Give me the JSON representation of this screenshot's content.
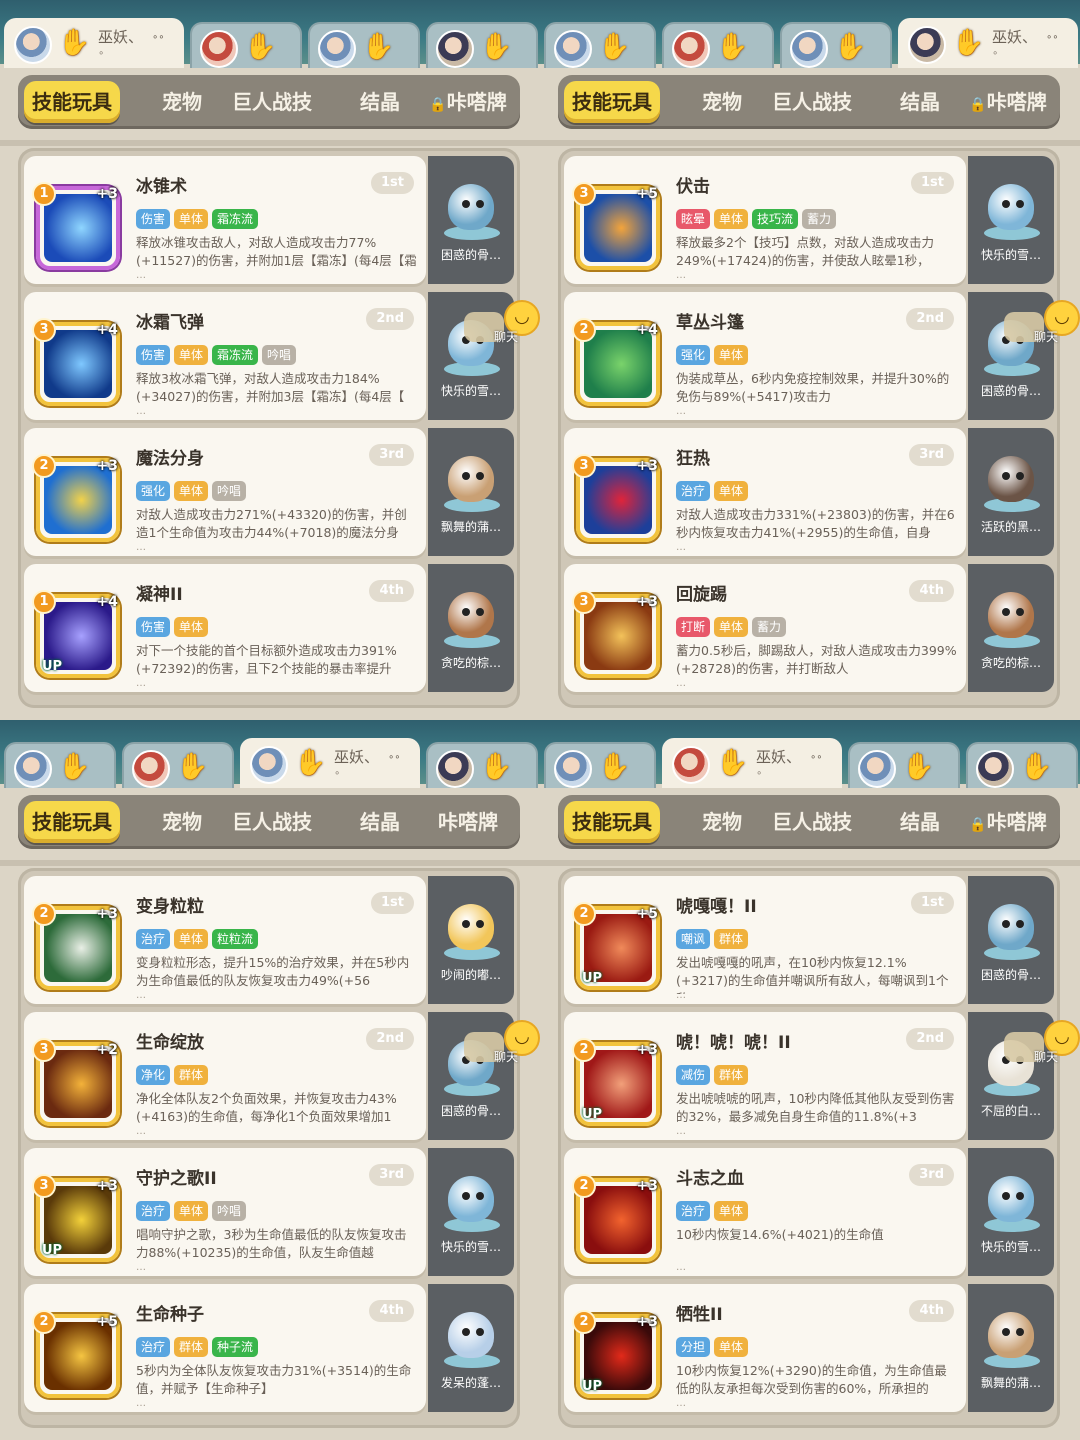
{
  "tabs": [
    "技能玩具",
    "宠物",
    "巨人战技",
    "结晶",
    "咔嗒牌"
  ],
  "chat_label": "聊天",
  "more_marker": "…",
  "player_name": "巫妖、",
  "panels": [
    {
      "active_player": 0,
      "locked_last_tab": true,
      "players": [
        {
          "avatar": "blue"
        },
        {
          "avatar": "red"
        },
        {
          "avatar": "blue"
        },
        {
          "avatar": "dark"
        }
      ],
      "chat": 1,
      "skills": [
        {
          "name": "冰锥术",
          "rank": "1st",
          "slot": "1",
          "plus": "+3",
          "up": false,
          "icon_color": "purple",
          "art": [
            "#1b4bb8",
            "#8fd6ff"
          ],
          "tags": [
            {
              "t": "伤害",
              "c": "#5aa6e0"
            },
            {
              "t": "单体",
              "c": "#f0b13d"
            },
            {
              "t": "霜冻流",
              "c": "#39b54a"
            }
          ],
          "desc": "释放冰锥攻击敌人，对敌人造成攻击力77%(+11527)的伤害，并附加1层【霜冻】(每4层【霜",
          "pet": "困惑的骨…",
          "pet_color": "#6fa8c9"
        },
        {
          "name": "冰霜飞弹",
          "rank": "2nd",
          "slot": "3",
          "plus": "+4",
          "up": false,
          "icon_color": "gold",
          "art": [
            "#103a8a",
            "#7fc8ff"
          ],
          "tags": [
            {
              "t": "伤害",
              "c": "#5aa6e0"
            },
            {
              "t": "单体",
              "c": "#f0b13d"
            },
            {
              "t": "霜冻流",
              "c": "#39b54a"
            },
            {
              "t": "吟唱",
              "c": "#b8b1a6"
            }
          ],
          "desc": "释放3枚冰霜飞弹，对敌人造成攻击力184%(+34027)的伤害，并附加3层【霜冻】(每4层【",
          "pet": "快乐的雪…",
          "pet_color": "#7fb6d8"
        },
        {
          "name": "魔法分身",
          "rank": "3rd",
          "slot": "2",
          "plus": "+3",
          "up": false,
          "icon_color": "gold",
          "art": [
            "#1f6fd1",
            "#f2d24a"
          ],
          "tags": [
            {
              "t": "强化",
              "c": "#5aa6e0"
            },
            {
              "t": "单体",
              "c": "#f0b13d"
            },
            {
              "t": "吟唱",
              "c": "#b8b1a6"
            }
          ],
          "desc": "对敌人造成攻击力271%(+43320)的伤害，并创造1个生命值为攻击力44%(+7018)的魔法分身",
          "pet": "飘舞的蒲…",
          "pet_color": "#c9a074"
        },
        {
          "name": "凝神II",
          "rank": "4th",
          "slot": "1",
          "plus": "+4",
          "up": true,
          "icon_color": "gold",
          "art": [
            "#2b1a8a",
            "#a7a1ff"
          ],
          "tags": [
            {
              "t": "伤害",
              "c": "#5aa6e0"
            },
            {
              "t": "单体",
              "c": "#f0b13d"
            }
          ],
          "desc": "对下一个技能的首个目标额外造成攻击力391%(+72392)的伤害，且下2个技能的暴击率提升",
          "pet": "贪吃的棕…",
          "pet_color": "#b0764a"
        }
      ]
    },
    {
      "active_player": 3,
      "locked_last_tab": true,
      "players": [
        {
          "avatar": "blue"
        },
        {
          "avatar": "red"
        },
        {
          "avatar": "blue"
        },
        {
          "avatar": "dark"
        }
      ],
      "chat": 1,
      "skills": [
        {
          "name": "伏击",
          "rank": "1st",
          "slot": "3",
          "plus": "+5",
          "up": false,
          "icon_color": "gold",
          "art": [
            "#1c4fa8",
            "#f3a43b"
          ],
          "tags": [
            {
              "t": "眩晕",
              "c": "#e8586a"
            },
            {
              "t": "单体",
              "c": "#f0b13d"
            },
            {
              "t": "技巧流",
              "c": "#39b54a"
            },
            {
              "t": "蓄力",
              "c": "#b8b1a6"
            }
          ],
          "desc": "释放最多2个【技巧】点数，对敌人造成攻击力249%(+17424)的伤害，并使敌人眩晕1秒，",
          "pet": "快乐的雪…",
          "pet_color": "#7fb6d8"
        },
        {
          "name": "草丛斗篷",
          "rank": "2nd",
          "slot": "2",
          "plus": "+4",
          "up": false,
          "icon_color": "gold",
          "art": [
            "#1f7f4b",
            "#7ad36b"
          ],
          "tags": [
            {
              "t": "强化",
              "c": "#5aa6e0"
            },
            {
              "t": "单体",
              "c": "#f0b13d"
            }
          ],
          "desc": "伪装成草丛，6秒内免疫控制效果，并提升30%的免伤与89%(+5417)攻击力",
          "pet": "困惑的骨…",
          "pet_color": "#6fa8c9"
        },
        {
          "name": "狂热",
          "rank": "3rd",
          "slot": "3",
          "plus": "+3",
          "up": false,
          "icon_color": "gold",
          "art": [
            "#1d3f9a",
            "#e0243a"
          ],
          "tags": [
            {
              "t": "治疗",
              "c": "#5aa6e0"
            },
            {
              "t": "单体",
              "c": "#f0b13d"
            }
          ],
          "desc": "对敌人造成攻击力331%(+23803)的伤害，并在6秒内恢复攻击力41%(+2955)的生命值，自身",
          "pet": "活跃的黑…",
          "pet_color": "#6b5446"
        },
        {
          "name": "回旋踢",
          "rank": "4th",
          "slot": "3",
          "plus": "+3",
          "up": false,
          "icon_color": "gold",
          "art": [
            "#8a3a12",
            "#f3c25a"
          ],
          "tags": [
            {
              "t": "打断",
              "c": "#e8586a"
            },
            {
              "t": "单体",
              "c": "#f0b13d"
            },
            {
              "t": "蓄力",
              "c": "#b8b1a6"
            }
          ],
          "desc": "蓄力0.5秒后，脚踢敌人，对敌人造成攻击力399%(+28728)的伤害，并打断敌人",
          "pet": "贪吃的棕…",
          "pet_color": "#b0764a"
        }
      ]
    },
    {
      "active_player": 2,
      "locked_last_tab": false,
      "players": [
        {
          "avatar": "blue"
        },
        {
          "avatar": "red"
        },
        {
          "avatar": "blue"
        },
        {
          "avatar": "dark"
        }
      ],
      "chat": 1,
      "skills": [
        {
          "name": "变身粒粒",
          "rank": "1st",
          "slot": "2",
          "plus": "+3",
          "up": false,
          "icon_color": "gold",
          "art": [
            "#2d6b3a",
            "#e9efe6"
          ],
          "tags": [
            {
              "t": "治疗",
              "c": "#5aa6e0"
            },
            {
              "t": "单体",
              "c": "#f0b13d"
            },
            {
              "t": "粒粒流",
              "c": "#39b54a"
            }
          ],
          "desc": "变身粒粒形态，提升15%的治疗效果，并在5秒内为生命值最低的队友恢复攻击力49%(+56",
          "pet": "吵闹的嘟…",
          "pet_color": "#f2c65a"
        },
        {
          "name": "生命绽放",
          "rank": "2nd",
          "slot": "3",
          "plus": "+2",
          "up": false,
          "icon_color": "gold",
          "art": [
            "#6b2a10",
            "#f3b23a"
          ],
          "tags": [
            {
              "t": "净化",
              "c": "#5aa6e0"
            },
            {
              "t": "群体",
              "c": "#f0b13d"
            }
          ],
          "desc": "净化全体队友2个负面效果，并恢复攻击力43%(+4163)的生命值，每净化1个负面效果增加1",
          "pet": "困惑的骨…",
          "pet_color": "#6fa8c9"
        },
        {
          "name": "守护之歌II",
          "rank": "3rd",
          "slot": "3",
          "plus": "+3",
          "up": true,
          "icon_color": "gold",
          "art": [
            "#5a3a0a",
            "#f3d13a"
          ],
          "tags": [
            {
              "t": "治疗",
              "c": "#5aa6e0"
            },
            {
              "t": "单体",
              "c": "#f0b13d"
            },
            {
              "t": "吟唱",
              "c": "#b8b1a6"
            }
          ],
          "desc": "唱响守护之歌，3秒为生命值最低的队友恢复攻击力88%(+10235)的生命值，队友生命值越",
          "pet": "快乐的雪…",
          "pet_color": "#7fb6d8"
        },
        {
          "name": "生命种子",
          "rank": "4th",
          "slot": "2",
          "plus": "+5",
          "up": false,
          "icon_color": "gold",
          "art": [
            "#6a3000",
            "#f5c542"
          ],
          "tags": [
            {
              "t": "治疗",
              "c": "#5aa6e0"
            },
            {
              "t": "群体",
              "c": "#f0b13d"
            },
            {
              "t": "种子流",
              "c": "#39b54a"
            }
          ],
          "desc": "5秒内为全体队友恢复攻击力31%(+3514)的生命值，并赋予【生命种子】",
          "pet": "发呆的蓬…",
          "pet_color": "#b7cfe8"
        }
      ]
    },
    {
      "active_player": 1,
      "locked_last_tab": true,
      "players": [
        {
          "avatar": "blue"
        },
        {
          "avatar": "red"
        },
        {
          "avatar": "blue"
        },
        {
          "avatar": "dark"
        }
      ],
      "chat": 1,
      "skills": [
        {
          "name": "唬嘎嘎！II",
          "rank": "1st",
          "slot": "2",
          "plus": "+5",
          "up": true,
          "icon_color": "gold",
          "art": [
            "#9a1a12",
            "#f08a5a"
          ],
          "tags": [
            {
              "t": "嘲讽",
              "c": "#5aa6e0"
            },
            {
              "t": "群体",
              "c": "#f0b13d"
            }
          ],
          "desc": "发出唬嘎嘎的吼声，在10秒内恢复12.1%(+3217)的生命值并嘲讽所有敌人，每嘲讽到1个敌",
          "pet": "困惑的骨…",
          "pet_color": "#6fa8c9"
        },
        {
          "name": "唬！唬！唬！II",
          "rank": "2nd",
          "slot": "2",
          "plus": "+3",
          "up": true,
          "icon_color": "gold",
          "art": [
            "#a01818",
            "#f2a07a"
          ],
          "tags": [
            {
              "t": "减伤",
              "c": "#5aa6e0"
            },
            {
              "t": "群体",
              "c": "#f0b13d"
            }
          ],
          "desc": "发出唬唬唬的吼声，10秒内降低其他队友受到伤害的32%，最多减免自身生命值的11.8%(+3",
          "pet": "不屈的白…",
          "pet_color": "#e8e2d6"
        },
        {
          "name": "斗志之血",
          "rank": "3rd",
          "slot": "2",
          "plus": "+3",
          "up": false,
          "icon_color": "gold",
          "art": [
            "#8a0e0e",
            "#f2632e"
          ],
          "tags": [
            {
              "t": "治疗",
              "c": "#5aa6e0"
            },
            {
              "t": "单体",
              "c": "#f0b13d"
            }
          ],
          "desc": "10秒内恢复14.6%(+4021)的生命值",
          "pet": "快乐的雪…",
          "pet_color": "#7fb6d8"
        },
        {
          "name": "牺牲II",
          "rank": "4th",
          "slot": "2",
          "plus": "+3",
          "up": true,
          "icon_color": "gold",
          "art": [
            "#3a0a0a",
            "#e22a1a"
          ],
          "tags": [
            {
              "t": "分担",
              "c": "#5aa6e0"
            },
            {
              "t": "单体",
              "c": "#f0b13d"
            }
          ],
          "desc": "10秒内恢复12%(+3290)的生命值，为生命值最低的队友承担每次受到伤害的60%，所承担的",
          "pet": "飘舞的蒲…",
          "pet_color": "#c9a074"
        }
      ]
    }
  ]
}
